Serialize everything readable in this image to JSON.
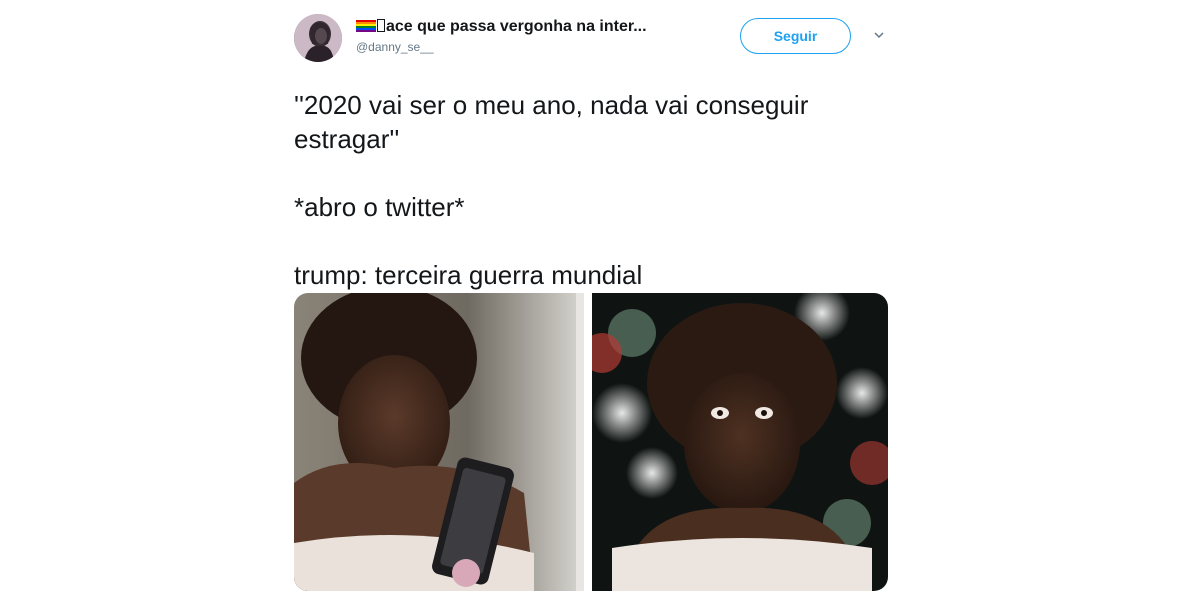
{
  "tweet": {
    "display_name": "ace que passa vergonha na inter...",
    "handle": "@danny_se__",
    "follow_label": "Seguir",
    "paragraphs": [
      "''2020 vai ser o meu ano, nada vai conseguir estragar''",
      "*abro o twitter*",
      "trump: terceira guerra mundial"
    ]
  },
  "icons": {
    "flag": "rainbow-flag-icon",
    "missing_glyph": "tofu-icon",
    "caret": "chevron-down-icon"
  },
  "colors": {
    "accent": "#1da1f2",
    "text": "#14171a",
    "muted": "#657786"
  }
}
